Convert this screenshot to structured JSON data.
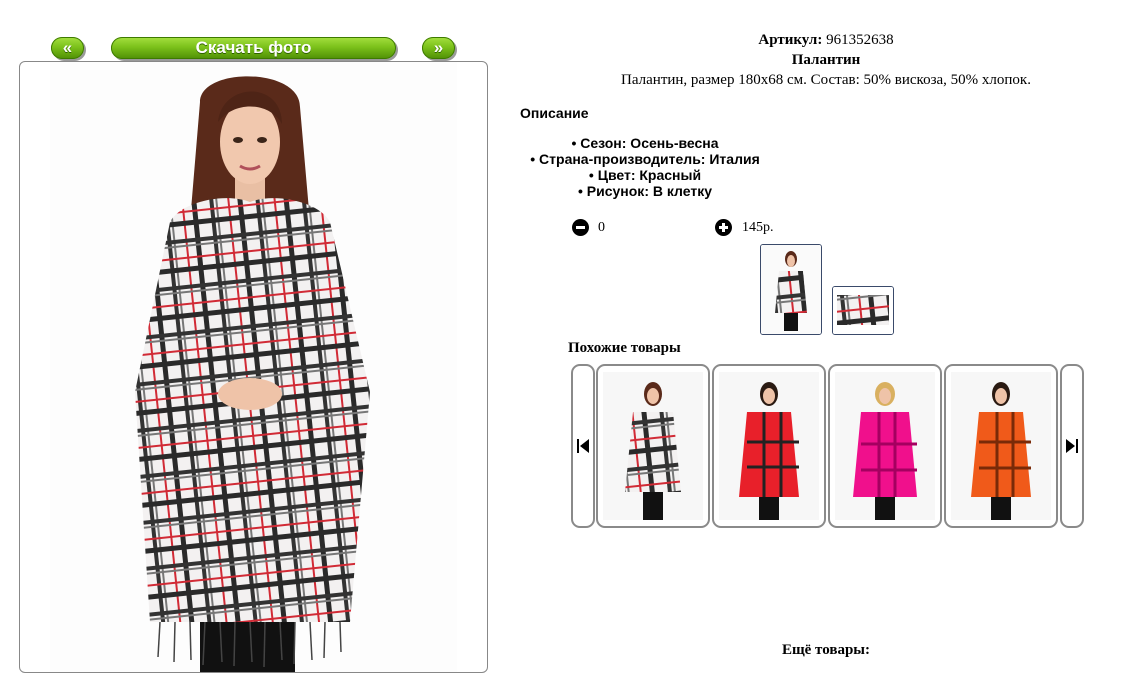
{
  "nav": {
    "prev_label": "«",
    "download_label": "Скачать фото",
    "next_label": "»"
  },
  "product": {
    "article_label": "Артикул:",
    "article_value": "961352638",
    "title": "Палантин",
    "description": "Палантин, размер 180х68 см. Состав: 50% вискоза, 50% хлопок."
  },
  "description_heading": "Описание",
  "attributes": [
    "Сезон: Осень-весна",
    "Страна-производитель: Италия",
    "Цвет: Красный",
    "Рисунок: В клетку"
  ],
  "order": {
    "quantity": "0",
    "price": "145р."
  },
  "similar": {
    "heading": "Похожие товары",
    "items": [
      {
        "color": "#f2eeee"
      },
      {
        "color": "#e8202a"
      },
      {
        "color": "#f0108c"
      },
      {
        "color": "#f05a1a"
      }
    ]
  },
  "more_heading": "Ещё товары:",
  "colors": {
    "button_green": "#7cc21b",
    "frame_border": "#888888",
    "thumb_border": "#3a4a6a"
  }
}
